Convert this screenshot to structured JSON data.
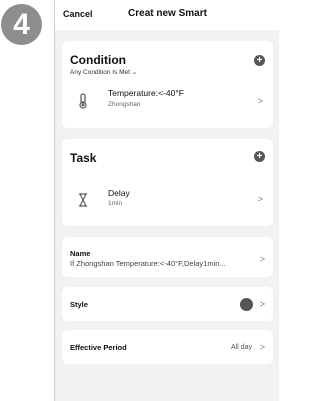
{
  "step_number": "4",
  "header": {
    "cancel": "Cancel",
    "title": "Creat new Smart"
  },
  "condition": {
    "title": "Condition",
    "mode": "Any Condition Is Met",
    "mode_chevron": "⌄",
    "item": {
      "icon": "thermometer-icon",
      "title": "Temperature:<-40°F",
      "subtitle": "Zhongshan"
    }
  },
  "task": {
    "title": "Task",
    "item": {
      "icon": "hourglass-icon",
      "title": "Delay",
      "subtitle": "1min"
    }
  },
  "name_row": {
    "label": "Name",
    "value": "If Zhongshan Temperature:<-40°F,Delay1min..."
  },
  "style_row": {
    "label": "Style",
    "color": "#555555"
  },
  "period_row": {
    "label": "Effective Period",
    "value": "All day"
  },
  "icons": {
    "plus": "+",
    "chevron": ">"
  }
}
